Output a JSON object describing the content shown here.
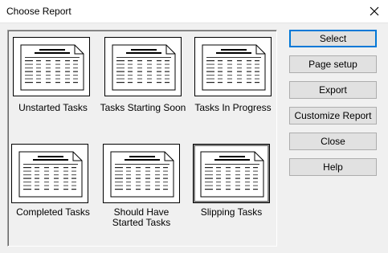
{
  "window": {
    "title": "Choose Report"
  },
  "reports": [
    {
      "label": "Unstarted Tasks",
      "selected": false,
      "icon": "report-document-icon"
    },
    {
      "label": "Tasks Starting Soon",
      "selected": false,
      "icon": "report-document-icon"
    },
    {
      "label": "Tasks In Progress",
      "selected": false,
      "icon": "report-document-icon"
    },
    {
      "label": "Completed Tasks",
      "selected": false,
      "icon": "report-document-icon"
    },
    {
      "label": "Should Have\nStarted Tasks",
      "selected": false,
      "icon": "report-document-icon"
    },
    {
      "label": "Slipping Tasks",
      "selected": true,
      "icon": "report-document-icon"
    }
  ],
  "buttons": {
    "select": "Select",
    "page_setup": "Page setup",
    "export": "Export",
    "customize": "Customize Report",
    "close": "Close",
    "help": "Help"
  },
  "colors": {
    "accent": "#0078d7",
    "background": "#f0f0f0"
  }
}
